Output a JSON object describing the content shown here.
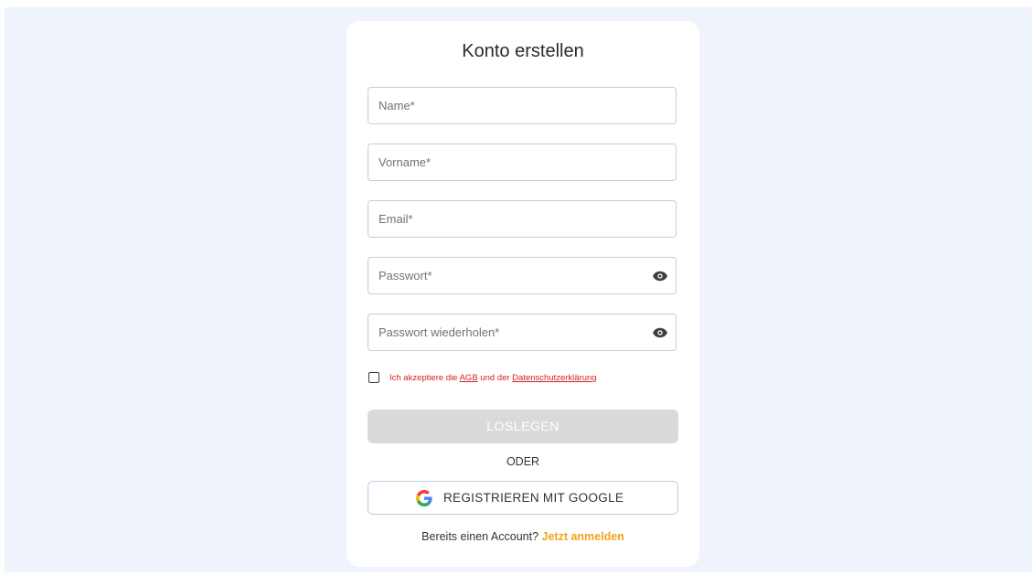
{
  "form": {
    "title": "Konto erstellen",
    "fields": [
      {
        "placeholder": "Name*",
        "value": ""
      },
      {
        "placeholder": "Vorname*",
        "value": ""
      },
      {
        "placeholder": "Email*",
        "value": ""
      },
      {
        "placeholder": "Passwort*",
        "value": "",
        "icon": "eye-icon"
      },
      {
        "placeholder": "Passwort wiederholen*",
        "value": "",
        "icon": "eye-icon"
      }
    ],
    "consent": {
      "checked": false,
      "text_prefix": "Ich akzeptiere die",
      "agb_link": "AGB",
      "text_middle": "und der",
      "privacy_link": "Datenschutzerklärung",
      "color": "#d32020"
    },
    "submit_label": "LOSLEGEN",
    "divider_label": "ODER",
    "google_label": "REGISTRIEREN MIT GOOGLE",
    "google_icon": "google-icon",
    "signin_prompt": "Bereits einen Account?",
    "signin_link": "Jetzt anmelden"
  },
  "colors": {
    "background": "#eff4fc",
    "card": "#ffffff",
    "submit_disabled": "#dadada",
    "link_accent": "#f5a21a",
    "google_border": "#b9cfe4"
  }
}
